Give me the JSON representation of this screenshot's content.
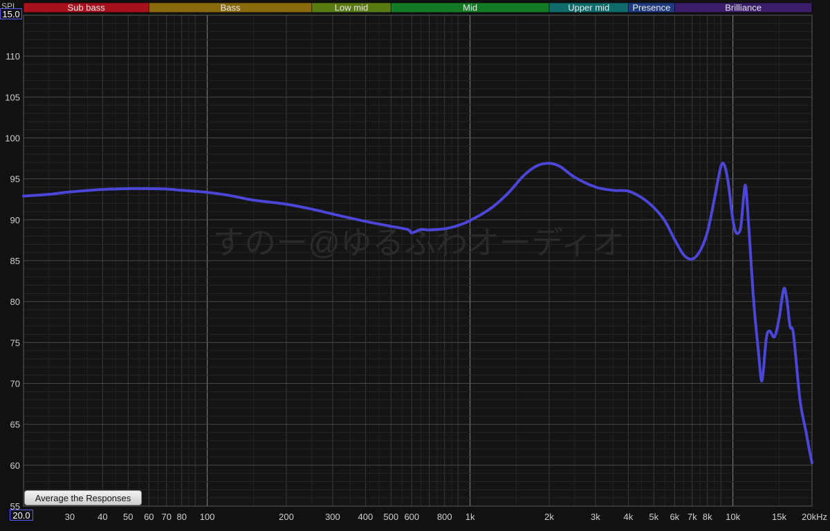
{
  "chart_data": {
    "type": "line",
    "ylabel": "SPL",
    "xlabel": "",
    "x_scale": "log",
    "xlim": [
      20,
      20000
    ],
    "ylim": [
      55,
      115
    ],
    "y_max_field": "15.0",
    "x_min_field": "20.0",
    "y_ticks": [
      "110",
      "105",
      "100",
      "95",
      "90",
      "85",
      "80",
      "75",
      "70",
      "65",
      "60",
      "55"
    ],
    "x_ticks": [
      {
        "f": 30,
        "label": "30"
      },
      {
        "f": 40,
        "label": "40"
      },
      {
        "f": 50,
        "label": "50"
      },
      {
        "f": 60,
        "label": "60"
      },
      {
        "f": 70,
        "label": "70"
      },
      {
        "f": 80,
        "label": "80"
      },
      {
        "f": 100,
        "label": "100"
      },
      {
        "f": 200,
        "label": "200"
      },
      {
        "f": 300,
        "label": "300"
      },
      {
        "f": 400,
        "label": "400"
      },
      {
        "f": 500,
        "label": "500"
      },
      {
        "f": 600,
        "label": "600"
      },
      {
        "f": 800,
        "label": "800"
      },
      {
        "f": 1000,
        "label": "1k"
      },
      {
        "f": 2000,
        "label": "2k"
      },
      {
        "f": 3000,
        "label": "3k"
      },
      {
        "f": 4000,
        "label": "4k"
      },
      {
        "f": 5000,
        "label": "5k"
      },
      {
        "f": 6000,
        "label": "6k"
      },
      {
        "f": 7000,
        "label": "7k"
      },
      {
        "f": 8000,
        "label": "8k"
      },
      {
        "f": 10000,
        "label": "10k"
      },
      {
        "f": 15000,
        "label": "15k"
      },
      {
        "f": 20000,
        "label": "20kHz"
      }
    ],
    "bands": [
      {
        "name": "Sub bass",
        "from": 20,
        "to": 60,
        "color": "#a8101c"
      },
      {
        "name": "Bass",
        "from": 60,
        "to": 250,
        "color": "#8a6a0e"
      },
      {
        "name": "Low mid",
        "from": 250,
        "to": 500,
        "color": "#5a7a12"
      },
      {
        "name": "Mid",
        "from": 500,
        "to": 2000,
        "color": "#157a25"
      },
      {
        "name": "Upper mid",
        "from": 2000,
        "to": 4000,
        "color": "#0f6a6a"
      },
      {
        "name": "Presence",
        "from": 4000,
        "to": 6000,
        "color": "#1e3a80"
      },
      {
        "name": "Brilliance",
        "from": 6000,
        "to": 20000,
        "color": "#3a1e6a"
      }
    ],
    "watermark": "すのー@ゆるふわオーディオ",
    "series": [
      {
        "color": "#4b46d8",
        "points": [
          [
            20,
            92.9
          ],
          [
            25,
            93.1
          ],
          [
            30,
            93.4
          ],
          [
            40,
            93.7
          ],
          [
            50,
            93.8
          ],
          [
            60,
            93.8
          ],
          [
            70,
            93.75
          ],
          [
            80,
            93.6
          ],
          [
            100,
            93.35
          ],
          [
            120,
            93.0
          ],
          [
            150,
            92.4
          ],
          [
            200,
            91.9
          ],
          [
            250,
            91.3
          ],
          [
            300,
            90.7
          ],
          [
            400,
            89.8
          ],
          [
            500,
            89.2
          ],
          [
            580,
            88.8
          ],
          [
            600,
            88.4
          ],
          [
            650,
            88.8
          ],
          [
            700,
            88.75
          ],
          [
            800,
            88.9
          ],
          [
            900,
            89.3
          ],
          [
            1000,
            89.9
          ],
          [
            1200,
            91.4
          ],
          [
            1400,
            93.3
          ],
          [
            1600,
            95.4
          ],
          [
            1800,
            96.6
          ],
          [
            2000,
            96.9
          ],
          [
            2200,
            96.5
          ],
          [
            2500,
            95.2
          ],
          [
            3000,
            94.0
          ],
          [
            3500,
            93.6
          ],
          [
            4000,
            93.5
          ],
          [
            4500,
            92.7
          ],
          [
            5000,
            91.5
          ],
          [
            5500,
            89.9
          ],
          [
            6000,
            87.6
          ],
          [
            6500,
            85.7
          ],
          [
            7000,
            85.2
          ],
          [
            7500,
            86.2
          ],
          [
            8000,
            88.5
          ],
          [
            8500,
            92.5
          ],
          [
            9000,
            96.5
          ],
          [
            9300,
            96.6
          ],
          [
            9600,
            94.5
          ],
          [
            10000,
            90.0
          ],
          [
            10300,
            88.4
          ],
          [
            10700,
            89.0
          ],
          [
            11000,
            93.0
          ],
          [
            11200,
            94.0
          ],
          [
            11500,
            89.0
          ],
          [
            12000,
            80.0
          ],
          [
            12500,
            74.0
          ],
          [
            12900,
            70.3
          ],
          [
            13400,
            75.5
          ],
          [
            13800,
            76.4
          ],
          [
            14400,
            75.7
          ],
          [
            15000,
            78.0
          ],
          [
            15600,
            81.5
          ],
          [
            16000,
            80.5
          ],
          [
            16500,
            77.0
          ],
          [
            17000,
            76.0
          ],
          [
            18000,
            68.0
          ],
          [
            19000,
            64.0
          ],
          [
            19500,
            62.0
          ],
          [
            20000,
            60.3
          ]
        ]
      }
    ]
  },
  "ui": {
    "avg_button_label": "Average the Responses",
    "spl_label": "SPL"
  }
}
